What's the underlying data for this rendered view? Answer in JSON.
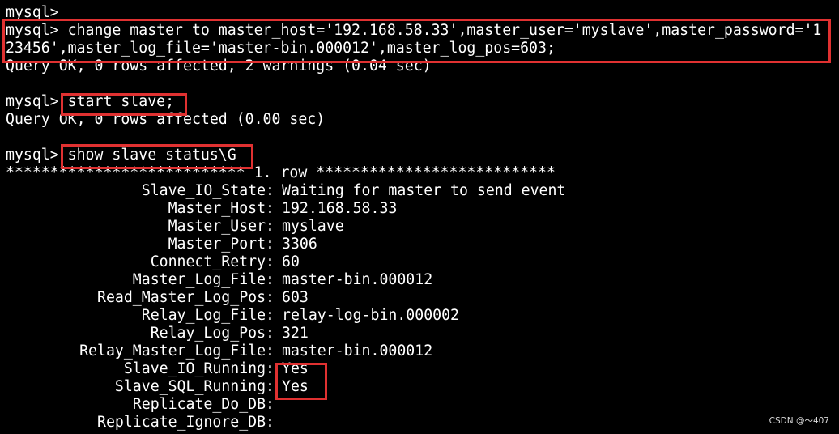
{
  "terminal": {
    "prompt_top": "mysql>",
    "cmd1_line1": "mysql> change master to master_host='192.168.58.33',master_user='myslave',master_password='1",
    "cmd1_line2": "23456',master_log_file='master-bin.000012',master_log_pos=603;",
    "result1": "Query OK, 0 rows affected, 2 warnings (0.04 sec)",
    "prompt2": "mysql>",
    "cmd2": "start slave;",
    "result2": "Query OK, 0 rows affected (0.00 sec)",
    "prompt3": "mysql>",
    "cmd3": "show slave status\\G",
    "row_header": "*************************** 1. row ***************************",
    "fields": [
      {
        "name": "Slave_IO_State:",
        "value": "Waiting for master to send event"
      },
      {
        "name": "Master_Host:",
        "value": "192.168.58.33"
      },
      {
        "name": "Master_User:",
        "value": "myslave"
      },
      {
        "name": "Master_Port:",
        "value": "3306"
      },
      {
        "name": "Connect_Retry:",
        "value": "60"
      },
      {
        "name": "Master_Log_File:",
        "value": "master-bin.000012"
      },
      {
        "name": "Read_Master_Log_Pos:",
        "value": "603"
      },
      {
        "name": "Relay_Log_File:",
        "value": "relay-log-bin.000002"
      },
      {
        "name": "Relay_Log_Pos:",
        "value": "321"
      },
      {
        "name": "Relay_Master_Log_File:",
        "value": "master-bin.000012"
      },
      {
        "name": "Slave_IO_Running:",
        "value": "Yes"
      },
      {
        "name": "Slave_SQL_Running:",
        "value": "Yes"
      },
      {
        "name": "Replicate_Do_DB:",
        "value": ""
      },
      {
        "name": "Replicate_Ignore_DB:",
        "value": ""
      }
    ]
  },
  "watermark": "CSDN @～407",
  "colors": {
    "background": "#000000",
    "text": "#ffffff",
    "highlight": "#e03131"
  }
}
